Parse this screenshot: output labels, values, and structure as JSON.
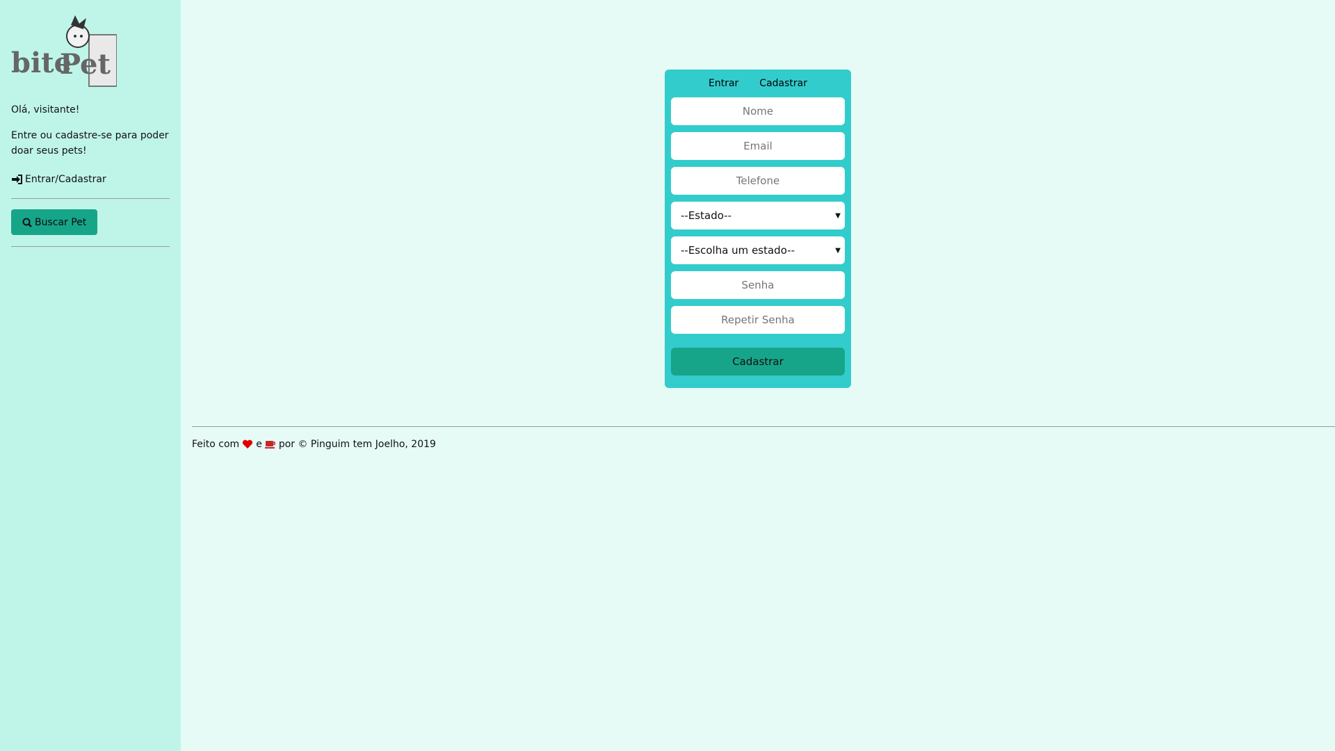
{
  "sidebar": {
    "logo_alt": "bite Pet",
    "greeting": "Olá, visitante!",
    "call_to_action": "Entre ou cadastre-se para poder doar seus pets!",
    "login_link": "Entrar/Cadastrar",
    "search_button": "Buscar Pet"
  },
  "form": {
    "tab_login": "Entrar",
    "tab_register": "Cadastrar",
    "name_placeholder": "Nome",
    "email_placeholder": "Email",
    "phone_placeholder": "Telefone",
    "state_select": "--Estado--",
    "city_select": "--Escolha um estado--",
    "password_placeholder": "Senha",
    "repeat_password_placeholder": "Repetir Senha",
    "submit_label": "Cadastrar"
  },
  "footer": {
    "part1": "Feito com",
    "part2": "e",
    "part3": "por © Pinguim tem Joelho, 2019"
  },
  "colors": {
    "sidebar_bg": "#bff5e9",
    "page_bg": "#e6fbf6",
    "card_bg": "#33cccc",
    "primary": "#17a589",
    "heart": "#e00000",
    "coffee": "#c62828"
  }
}
